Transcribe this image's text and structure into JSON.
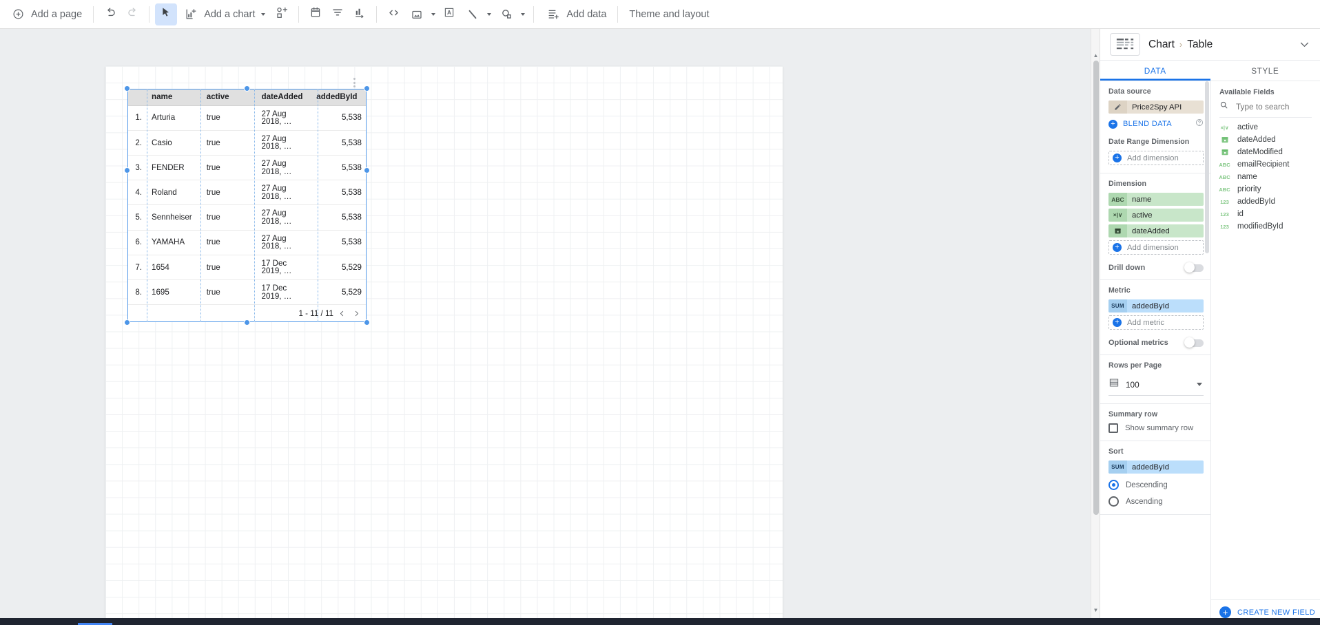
{
  "toolbar": {
    "add_page": "Add a page",
    "undo": "undo-icon",
    "redo": "redo-icon",
    "select": "cursor-icon",
    "add_chart": "Add a chart",
    "add_control": "add-control-icon",
    "date_range": "date-range-icon",
    "filter": "filter-icon",
    "sort_control": "sort-control-icon",
    "embed": "embed-icon",
    "image": "image-icon",
    "text": "text-box-icon",
    "line": "line-icon",
    "shape": "shape-icon",
    "add_data": "Add data",
    "theme_layout": "Theme and layout"
  },
  "chart_data": {
    "type": "table",
    "title": "Table",
    "columns": [
      "",
      "name",
      "active",
      "dateAdded",
      "addedById"
    ],
    "rows": [
      {
        "idx": "1.",
        "name": "Arturia",
        "active": "true",
        "dateAdded": "27 Aug 2018, …",
        "addedById": "5,538"
      },
      {
        "idx": "2.",
        "name": "Casio",
        "active": "true",
        "dateAdded": "27 Aug 2018, …",
        "addedById": "5,538"
      },
      {
        "idx": "3.",
        "name": "FENDER",
        "active": "true",
        "dateAdded": "27 Aug 2018, …",
        "addedById": "5,538"
      },
      {
        "idx": "4.",
        "name": "Roland",
        "active": "true",
        "dateAdded": "27 Aug 2018, …",
        "addedById": "5,538"
      },
      {
        "idx": "5.",
        "name": "Sennheiser",
        "active": "true",
        "dateAdded": "27 Aug 2018, …",
        "addedById": "5,538"
      },
      {
        "idx": "6.",
        "name": "YAMAHA",
        "active": "true",
        "dateAdded": "27 Aug 2018, …",
        "addedById": "5,538"
      },
      {
        "idx": "7.",
        "name": "1654",
        "active": "true",
        "dateAdded": "17 Dec 2019, …",
        "addedById": "5,529"
      },
      {
        "idx": "8.",
        "name": "1695",
        "active": "true",
        "dateAdded": "17 Dec 2019, …",
        "addedById": "5,529"
      }
    ],
    "pagination": "1 - 11 / 11",
    "prev": "‹",
    "next": "›"
  },
  "panel": {
    "breadcrumb_root": "Chart",
    "breadcrumb_sep": "›",
    "breadcrumb_leaf": "Table",
    "thumb_icon": "table-chart-icon",
    "collapse_icon": "chevron-down-icon",
    "tabs": [
      {
        "label": "DATA",
        "selected": true
      },
      {
        "label": "STYLE",
        "selected": false
      }
    ],
    "data_source": {
      "title": "Data source",
      "name": "Price2Spy API",
      "edit_icon": "pencil-icon",
      "blend_label": "BLEND DATA",
      "help_icon": "question-mark-icon"
    },
    "date_range": {
      "title": "Date Range Dimension",
      "add_label": "Add dimension"
    },
    "dimension": {
      "title": "Dimension",
      "items": [
        {
          "type": "ABC",
          "label": "name"
        },
        {
          "type": "×|∨",
          "label": "active"
        },
        {
          "type": "calendar",
          "label": "dateAdded"
        }
      ],
      "add_label": "Add dimension"
    },
    "drill_down": {
      "label": "Drill down",
      "on": false
    },
    "metric": {
      "title": "Metric",
      "items": [
        {
          "type": "SUM",
          "label": "addedById"
        }
      ],
      "add_label": "Add metric"
    },
    "optional_metrics": {
      "label": "Optional metrics",
      "on": false
    },
    "rows_per_page": {
      "title": "Rows per Page",
      "value": "100",
      "icon": "rows-icon"
    },
    "summary_row": {
      "title": "Summary row",
      "checkbox_label": "Show summary row",
      "checked": false
    },
    "sort": {
      "title": "Sort",
      "field": {
        "type": "SUM",
        "label": "addedById"
      },
      "options": [
        {
          "label": "Descending",
          "selected": true
        },
        {
          "label": "Ascending",
          "selected": false
        }
      ]
    },
    "available_fields": {
      "title": "Available Fields",
      "search_placeholder": "Type to search",
      "search_icon": "search-icon",
      "fields": [
        {
          "type": "×|∨",
          "label": "active"
        },
        {
          "type": "calendar",
          "label": "dateAdded"
        },
        {
          "type": "calendar",
          "label": "dateModified"
        },
        {
          "type": "ABC",
          "label": "emailRecipient"
        },
        {
          "type": "ABC",
          "label": "name"
        },
        {
          "type": "ABC",
          "label": "priority"
        },
        {
          "type": "123",
          "label": "addedById"
        },
        {
          "type": "123",
          "label": "id"
        },
        {
          "type": "123",
          "label": "modifiedById"
        }
      ],
      "create_label": "CREATE NEW FIELD"
    }
  },
  "colors": {
    "accent": "#1a73e8",
    "dimension_chip": "#c8e6c9",
    "metric_chip": "#bbdefb",
    "source_chip": "#e8e0d4",
    "selection": "#4d96e8"
  }
}
